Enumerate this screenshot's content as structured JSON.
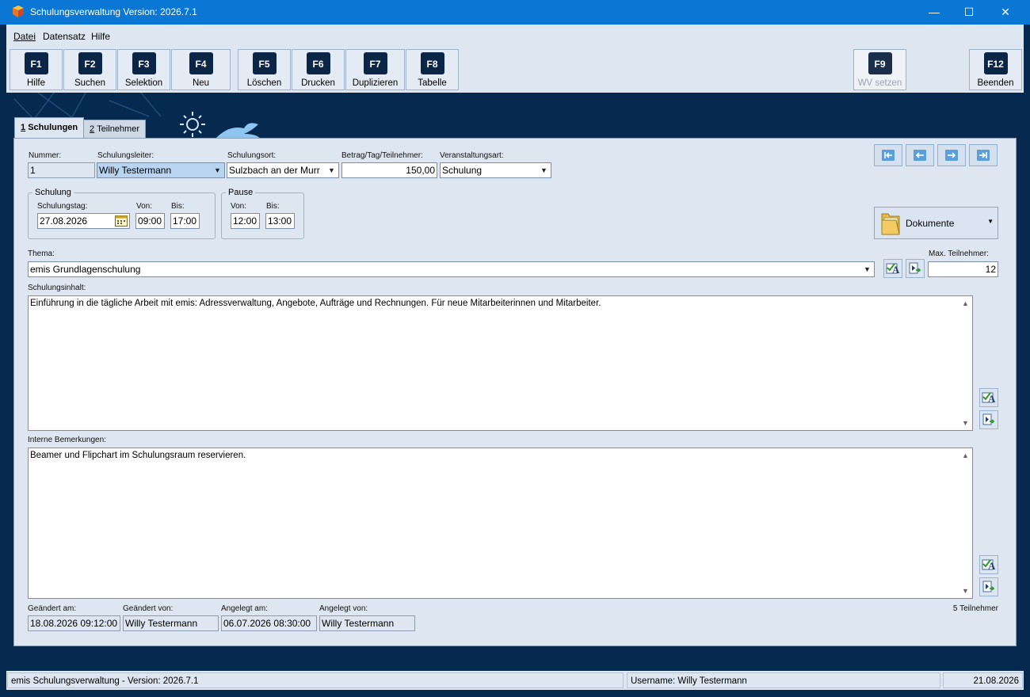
{
  "window": {
    "title": "Schulungsverwaltung Version: 2026.7.1",
    "minimize_glyph": "—",
    "maximize_glyph": "☐",
    "close_glyph": "✕"
  },
  "menu": {
    "items": [
      "Datei",
      "Datensatz",
      "Hilfe"
    ]
  },
  "toolbar": {
    "buttons": [
      {
        "key": "F1",
        "label": "Hilfe"
      },
      {
        "key": "F2",
        "label": "Suchen"
      },
      {
        "key": "F3",
        "label": "Selektion"
      },
      {
        "key": "F4",
        "label": "Neu"
      },
      {
        "key": "F5",
        "label": "Löschen"
      },
      {
        "key": "F6",
        "label": "Drucken"
      },
      {
        "key": "F7",
        "label": "Duplizieren"
      },
      {
        "key": "F8",
        "label": "Tabelle"
      },
      {
        "key": "F9",
        "label": "WV setzen",
        "disabled": true
      },
      {
        "key": "F12",
        "label": "Beenden"
      }
    ]
  },
  "tabs": [
    {
      "num": "1",
      "label": "Schulungen",
      "active": true
    },
    {
      "num": "2",
      "label": "Teilnehmer",
      "active": false
    }
  ],
  "form": {
    "nummer": {
      "label": "Nummer:",
      "value": "1"
    },
    "schulungsleiter": {
      "label": "Schulungsleiter:",
      "value": "Willy Testermann"
    },
    "schulungsort": {
      "label": "Schulungsort:",
      "value": "Sulzbach an der Murr"
    },
    "betrag": {
      "label": "Betrag/Tag/Teilnehmer:",
      "value": "150,00"
    },
    "veranstaltungsart": {
      "label": "Veranstaltungsart:",
      "value": "Schulung"
    },
    "schulung_group": {
      "title": "Schulung",
      "tag_label": "Schulungstag:",
      "tag_value": "27.08.2026",
      "von_label": "Von:",
      "von_value": "09:00",
      "bis_label": "Bis:",
      "bis_value": "17:00"
    },
    "pause_group": {
      "title": "Pause",
      "von_label": "Von:",
      "von_value": "12:00",
      "bis_label": "Bis:",
      "bis_value": "13:00"
    },
    "dokumente_label": "Dokumente",
    "thema": {
      "label": "Thema:",
      "value": "emis Grundlagenschulung"
    },
    "max_teilnehmer": {
      "label": "Max. Teilnehmer:",
      "value": "12"
    },
    "schulungsinhalt": {
      "label": "Schulungsinhalt:",
      "value": "Einführung in die tägliche Arbeit mit emis: Adressverwaltung, Angebote, Aufträge und Rechnungen. Für neue Mitarbeiterinnen und Mitarbeiter."
    },
    "bemerkungen": {
      "label": "Interne Bemerkungen:",
      "value": "Beamer und Flipchart im Schulungsraum reservieren."
    },
    "geaendert_am": {
      "label": "Geändert am:",
      "value": "18.08.2026 09:12:00"
    },
    "geaendert_von": {
      "label": "Geändert von:",
      "value": "Willy Testermann"
    },
    "angelegt_am": {
      "label": "Angelegt am:",
      "value": "06.07.2026 08:30:00"
    },
    "angelegt_von": {
      "label": "Angelegt von:",
      "value": "Willy Testermann"
    },
    "teilnehmer_count": "5 Teilnehmer"
  },
  "statusbar": {
    "app": "emis Schulungsverwaltung - Version: 2026.7.1",
    "user": "Username: Willy Testermann",
    "date": "21.08.2026"
  },
  "colors": {
    "titlebar": "#0a77d4",
    "background": "#05294f",
    "panel": "#dde6f1",
    "fkey": "#0b2547",
    "dokumente_border": "#e9962b"
  }
}
